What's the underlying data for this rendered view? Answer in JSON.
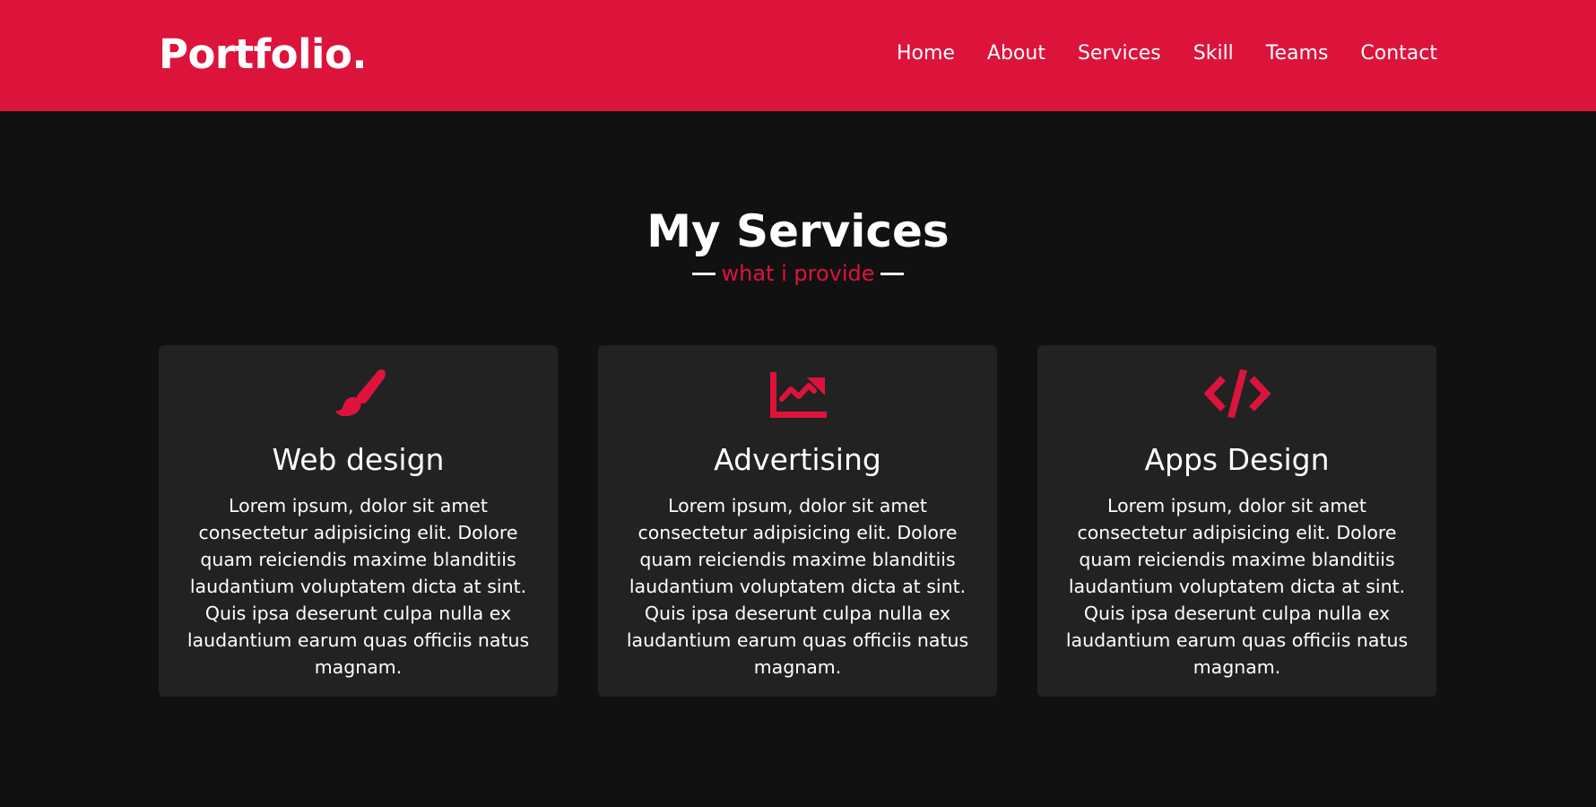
{
  "nav": {
    "logo": "Portfolio.",
    "links": [
      "Home",
      "About",
      "Services",
      "Skill",
      "Teams",
      "Contact"
    ]
  },
  "services": {
    "title": "My Services",
    "subtitle": "what i provide",
    "cards": [
      {
        "icon": "paint-brush-icon",
        "title": "Web design",
        "text": "Lorem ipsum, dolor sit amet consectetur adipisicing elit. Dolore quam reiciendis maxime blanditiis laudantium voluptatem dicta at sint. Quis ipsa deserunt culpa nulla ex laudantium earum quas officiis natus magnam."
      },
      {
        "icon": "chart-line-icon",
        "title": "Advertising",
        "text": "Lorem ipsum, dolor sit amet consectetur adipisicing elit. Dolore quam reiciendis maxime blanditiis laudantium voluptatem dicta at sint. Quis ipsa deserunt culpa nulla ex laudantium earum quas officiis natus magnam."
      },
      {
        "icon": "code-icon",
        "title": "Apps Design",
        "text": "Lorem ipsum, dolor sit amet consectetur adipisicing elit. Dolore quam reiciendis maxime blanditiis laudantium voluptatem dicta at sint. Quis ipsa deserunt culpa nulla ex laudantium earum quas officiis natus magnam."
      }
    ]
  },
  "colors": {
    "accent": "#dc143c",
    "background": "#111111",
    "card": "#222222",
    "text": "#ffffff"
  }
}
